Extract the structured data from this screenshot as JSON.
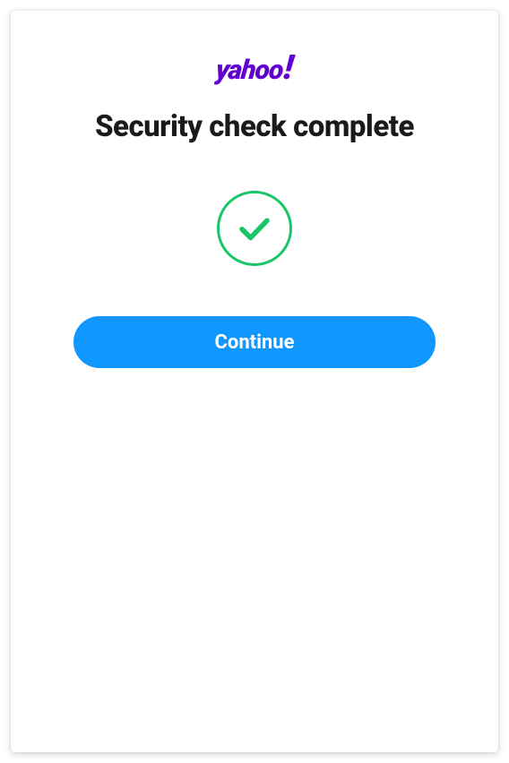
{
  "logo": {
    "text": "yahoo",
    "bang": "!"
  },
  "heading": "Security check complete",
  "icon": {
    "name": "check-circle"
  },
  "button": {
    "continue_label": "Continue"
  },
  "colors": {
    "brand": "#6001d2",
    "success": "#1ac567",
    "primary_button": "#0f96ff"
  }
}
